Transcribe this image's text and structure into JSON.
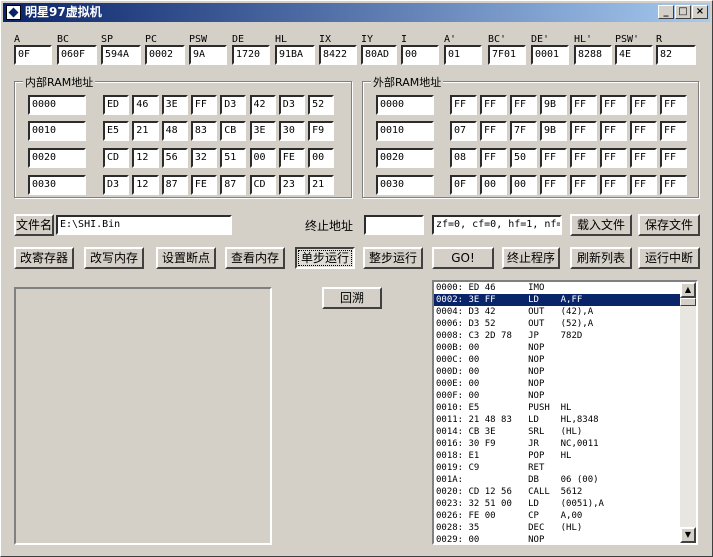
{
  "window": {
    "title": "明星97虚拟机",
    "min": "_",
    "max": "□",
    "close": "×"
  },
  "registers": [
    {
      "label": "A",
      "value": "0F"
    },
    {
      "label": "BC",
      "value": "060F"
    },
    {
      "label": "SP",
      "value": "594A"
    },
    {
      "label": "PC",
      "value": "0002"
    },
    {
      "label": "PSW",
      "value": "9A"
    },
    {
      "label": "DE",
      "value": "1720"
    },
    {
      "label": "HL",
      "value": "91BA"
    },
    {
      "label": "IX",
      "value": "8422"
    },
    {
      "label": "IY",
      "value": "80AD"
    },
    {
      "label": "I",
      "value": "00"
    },
    {
      "label": "A'",
      "value": "01"
    },
    {
      "label": "BC'",
      "value": "7F01"
    },
    {
      "label": "DE'",
      "value": "0001"
    },
    {
      "label": "HL'",
      "value": "8288"
    },
    {
      "label": "PSW'",
      "value": "4E"
    },
    {
      "label": "R",
      "value": "82"
    }
  ],
  "internal_ram": {
    "title": "内部RAM地址",
    "rows": [
      {
        "addr": "0000",
        "bytes": [
          "ED",
          "46",
          "3E",
          "FF",
          "D3",
          "42",
          "D3",
          "52"
        ]
      },
      {
        "addr": "0010",
        "bytes": [
          "E5",
          "21",
          "48",
          "83",
          "CB",
          "3E",
          "30",
          "F9"
        ]
      },
      {
        "addr": "0020",
        "bytes": [
          "CD",
          "12",
          "56",
          "32",
          "51",
          "00",
          "FE",
          "00"
        ]
      },
      {
        "addr": "0030",
        "bytes": [
          "D3",
          "12",
          "87",
          "FE",
          "87",
          "CD",
          "23",
          "21"
        ]
      }
    ]
  },
  "external_ram": {
    "title": "外部RAM地址",
    "rows": [
      {
        "addr": "0000",
        "bytes": [
          "FF",
          "FF",
          "FF",
          "9B",
          "FF",
          "FF",
          "FF",
          "FF"
        ]
      },
      {
        "addr": "0010",
        "bytes": [
          "07",
          "FF",
          "7F",
          "9B",
          "FF",
          "FF",
          "FF",
          "FF"
        ]
      },
      {
        "addr": "0020",
        "bytes": [
          "08",
          "FF",
          "50",
          "FF",
          "FF",
          "FF",
          "FF",
          "FF"
        ]
      },
      {
        "addr": "0030",
        "bytes": [
          "0F",
          "00",
          "00",
          "FF",
          "FF",
          "FF",
          "FF",
          "FF"
        ]
      }
    ]
  },
  "file": {
    "label": "文件名",
    "value": "E:\\SHI.Bin",
    "end_addr_label": "终止地址",
    "end_addr_value": "",
    "flags": "zf=0, cf=0, hf=1, nf=1,",
    "load": "载入文件",
    "save": "保存文件"
  },
  "actions": {
    "edit_reg": "改寄存器",
    "edit_mem": "改写内存",
    "breakpoint": "设置断点",
    "view_mem": "查看内存",
    "single_step": "单步运行",
    "step_over": "整步运行",
    "go": "GO!",
    "stop": "终止程序",
    "refresh": "刷新列表",
    "interrupt": "运行中断",
    "backtrack": "回溯"
  },
  "disasm": {
    "selected_index": 1,
    "rows": [
      "0000: ED 46      IMO",
      "0002: 3E FF      LD    A,FF",
      "0004: D3 42      OUT   (42),A",
      "0006: D3 52      OUT   (52),A",
      "0008: C3 2D 78   JP    782D",
      "000B: 00         NOP",
      "000C: 00         NOP",
      "000D: 00         NOP",
      "000E: 00         NOP",
      "000F: 00         NOP",
      "0010: E5         PUSH  HL",
      "0011: 21 48 83   LD    HL,8348",
      "0014: CB 3E      SRL   (HL)",
      "0016: 30 F9      JR    NC,0011",
      "0018: E1         POP   HL",
      "0019: C9         RET",
      "001A:            DB    06 (00)",
      "0020: CD 12 56   CALL  5612",
      "0023: 32 51 00   LD    (0051),A",
      "0026: FE 00      CP    A,00",
      "0028: 35         DEC   (HL)",
      "0029: 00         NOP"
    ],
    "scroll_up": "▲",
    "scroll_down": "▼"
  }
}
